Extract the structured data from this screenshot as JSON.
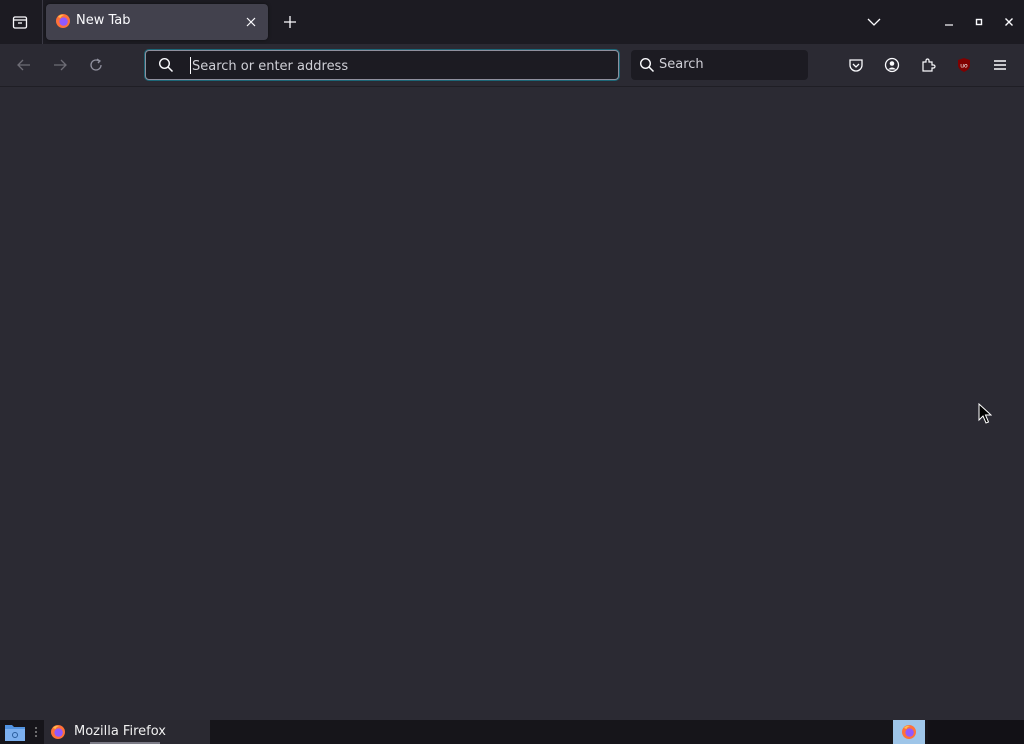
{
  "browser": {
    "tab": {
      "title": "New Tab"
    },
    "urlbar": {
      "placeholder": "Search or enter address"
    },
    "searchbar": {
      "placeholder": "Search"
    },
    "icons": {
      "tab_list": "tab-list-icon",
      "firefox": "firefox-icon",
      "close_tab": "close-icon",
      "new_tab": "plus-icon",
      "tab_overflow": "chevron-down-icon",
      "minimize": "minimize-icon",
      "maximize": "maximize-icon",
      "close_window": "close-icon",
      "back": "arrow-left-icon",
      "forward": "arrow-right-icon",
      "reload": "reload-icon",
      "search": "search-icon",
      "pocket": "pocket-icon",
      "account": "account-icon",
      "extensions": "puzzle-icon",
      "ublock": "ublock-icon",
      "menu": "hamburger-icon"
    },
    "colors": {
      "toolbar": "#2b2a33",
      "tabbar": "#1c1b22",
      "accent": "#00ddff",
      "ublock": "#800000"
    }
  },
  "taskbar": {
    "task_label": "Mozilla Firefox"
  }
}
